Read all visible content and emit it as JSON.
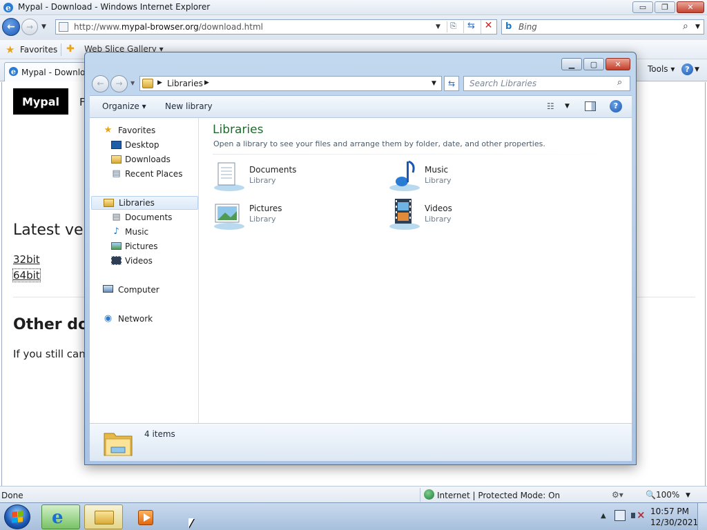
{
  "ie": {
    "window_title": "Mypal - Download - Windows Internet Explorer",
    "caption_buttons": {
      "minimize": "▭",
      "restore": "❐",
      "close": "✕"
    },
    "url_prefix": "http://www.",
    "url_domain": "mypal-browser.org",
    "url_path": "/download.html",
    "search_placeholder": "Bing",
    "favorites_label": "Favorites",
    "web_slice_label": "Web Slice Gallery ▾",
    "tab_label": "Mypal - Download",
    "tools_label": "Tools ▾",
    "help_glyph": "?",
    "status_done": "Done",
    "status_zone": "Internet | Protected Mode: On",
    "status_zoom": "🔍100%"
  },
  "web": {
    "brand": "Mypal",
    "nav_first_letter": "F",
    "latest_heading": "Latest vers",
    "link_32": "32bit",
    "link_64": "64bit",
    "other_heading": "Other dow",
    "other_text": "If you still can'"
  },
  "explorer": {
    "breadcrumb": "Libraries",
    "search_placeholder": "Search Libraries",
    "toolbar": {
      "organize": "Organize ▾",
      "new_library": "New library"
    },
    "nav": {
      "favorites": "Favorites",
      "desktop": "Desktop",
      "downloads": "Downloads",
      "recent_places": "Recent Places",
      "libraries": "Libraries",
      "documents": "Documents",
      "music": "Music",
      "pictures": "Pictures",
      "videos": "Videos",
      "computer": "Computer",
      "network": "Network"
    },
    "heading": "Libraries",
    "description": "Open a library to see your files and arrange them by folder, date, and other properties.",
    "items": [
      {
        "name": "Documents",
        "type": "Library"
      },
      {
        "name": "Music",
        "type": "Library"
      },
      {
        "name": "Pictures",
        "type": "Library"
      },
      {
        "name": "Videos",
        "type": "Library"
      }
    ],
    "details_count": "4 items"
  },
  "taskbar": {
    "time": "10:57 PM",
    "date": "12/30/2021"
  },
  "colors": {
    "library_heading": "#1d6a2c",
    "window_frame": "#a9c4e4",
    "taskbar": "#a7bfdc"
  }
}
